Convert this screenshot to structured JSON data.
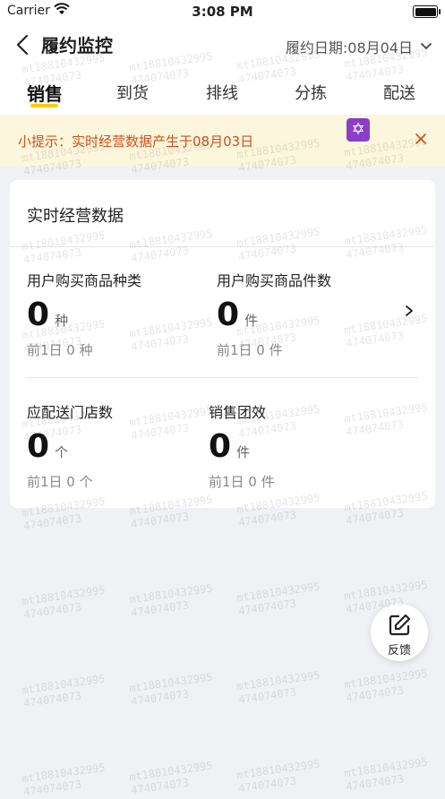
{
  "status_bar": {
    "carrier": "Carrier",
    "time": "3:08 PM"
  },
  "header": {
    "title": "履约监控",
    "date_label": "履约日期:",
    "date_value": "08月04日"
  },
  "tabs": [
    {
      "label": "销售",
      "active": true
    },
    {
      "label": "到货",
      "active": false
    },
    {
      "label": "排线",
      "active": false
    },
    {
      "label": "分拣",
      "active": false
    },
    {
      "label": "配送",
      "active": false
    }
  ],
  "tip": {
    "text": "小提示：实时经营数据产生于08月03日",
    "badge": "✡"
  },
  "card": {
    "title": "实时经营数据",
    "metrics": [
      {
        "label": "用户购买商品种类",
        "value": "0",
        "unit": "种",
        "prev": "前1日 0 种"
      },
      {
        "label": "用户购买商品件数",
        "value": "0",
        "unit": "件",
        "prev": "前1日 0 件"
      },
      {
        "label": "应配送门店数",
        "value": "0",
        "unit": "个",
        "prev": "前1日 0 个"
      },
      {
        "label": "销售团效",
        "value": "0",
        "unit": "件",
        "prev": "前1日 0 件"
      }
    ]
  },
  "feedback": {
    "label": "反馈"
  },
  "watermark": {
    "line1": "mt18810432995",
    "line2": "474074073"
  },
  "colors": {
    "accent": "#ffcc00",
    "tip_bg": "#fbf6dc",
    "tip_text": "#d2501d",
    "page_bg": "#f0f1f4"
  }
}
